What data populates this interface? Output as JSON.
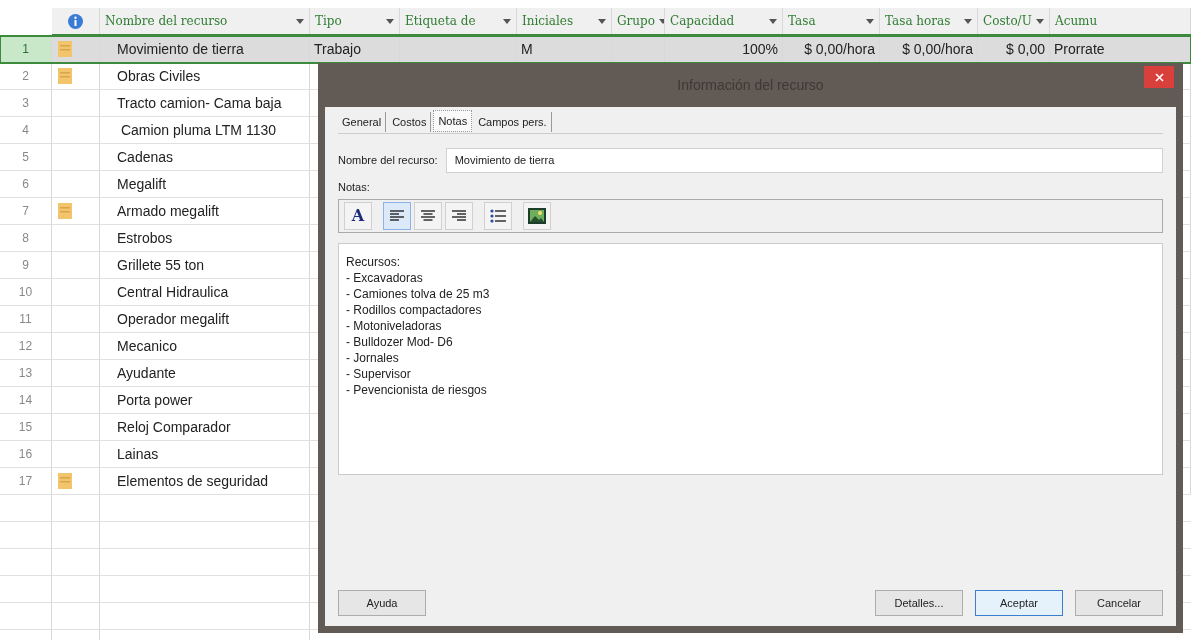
{
  "table": {
    "columns": [
      {
        "label": "Nombre del recurso",
        "kind": "text",
        "dropdown": true
      },
      {
        "label": "Tipo",
        "kind": "text",
        "dropdown": true
      },
      {
        "label": "Etiqueta de",
        "kind": "text",
        "dropdown": true
      },
      {
        "label": "Iniciales",
        "kind": "text",
        "dropdown": true
      },
      {
        "label": "Grupo",
        "kind": "text",
        "dropdown": true
      },
      {
        "label": "Capacidad",
        "kind": "number",
        "dropdown": true
      },
      {
        "label": "Tasa",
        "kind": "number",
        "dropdown": true
      },
      {
        "label": "Tasa horas",
        "kind": "number",
        "dropdown": true
      },
      {
        "label": "Costo/U",
        "kind": "number",
        "dropdown": true
      },
      {
        "label": "Acumu",
        "kind": "text",
        "dropdown": false
      }
    ],
    "rows": [
      {
        "number": "1",
        "notes": true,
        "selected": true,
        "cells": [
          "Movimiento de tierra",
          "Trabajo",
          null,
          "M",
          null,
          "100%",
          "$ 0,00/hora",
          "$ 0,00/hora",
          "$ 0,00",
          "Prorrate"
        ]
      },
      {
        "number": "2",
        "notes": true,
        "selected": false,
        "cells": [
          "Obras Civiles"
        ]
      },
      {
        "number": "3",
        "notes": false,
        "selected": false,
        "cells": [
          "Tracto camion- Cama baja"
        ]
      },
      {
        "number": "4",
        "notes": false,
        "selected": false,
        "cells": [
          " Camion pluma LTM 1130"
        ]
      },
      {
        "number": "5",
        "notes": false,
        "selected": false,
        "cells": [
          "Cadenas"
        ]
      },
      {
        "number": "6",
        "notes": false,
        "selected": false,
        "cells": [
          "Megalift"
        ]
      },
      {
        "number": "7",
        "notes": true,
        "selected": false,
        "cells": [
          "Armado megalift"
        ]
      },
      {
        "number": "8",
        "notes": false,
        "selected": false,
        "cells": [
          "Estrobos"
        ]
      },
      {
        "number": "9",
        "notes": false,
        "selected": false,
        "cells": [
          "Grillete 55 ton"
        ]
      },
      {
        "number": "10",
        "notes": false,
        "selected": false,
        "cells": [
          "Central Hidraulica"
        ]
      },
      {
        "number": "11",
        "notes": false,
        "selected": false,
        "cells": [
          "Operador megalift"
        ]
      },
      {
        "number": "12",
        "notes": false,
        "selected": false,
        "cells": [
          "Mecanico"
        ]
      },
      {
        "number": "13",
        "notes": false,
        "selected": false,
        "cells": [
          "Ayudante"
        ]
      },
      {
        "number": "14",
        "notes": false,
        "selected": false,
        "cells": [
          "Porta power"
        ]
      },
      {
        "number": "15",
        "notes": false,
        "selected": false,
        "cells": [
          "Reloj Comparador"
        ]
      },
      {
        "number": "16",
        "notes": false,
        "selected": false,
        "cells": [
          "Lainas"
        ]
      },
      {
        "number": "17",
        "notes": true,
        "selected": false,
        "cells": [
          "Elementos de seguridad"
        ]
      }
    ]
  },
  "dialog": {
    "title": "Información del recurso",
    "tabs": [
      {
        "label": "General",
        "selected": false
      },
      {
        "label": "Costos",
        "selected": false
      },
      {
        "label": "Notas",
        "selected": true
      },
      {
        "label": "Campos pers.",
        "selected": false
      }
    ],
    "name_label": "Nombre del recurso:",
    "name_value": "Movimiento de tierra",
    "notes_label": "Notas:",
    "toolbar": [
      {
        "kind": "font",
        "label": "A",
        "selected": false
      },
      {
        "kind": "align-left",
        "selected": true
      },
      {
        "kind": "align-center",
        "selected": false
      },
      {
        "kind": "align-right",
        "selected": false
      },
      {
        "kind": "bullets",
        "selected": false
      },
      {
        "kind": "image",
        "selected": false
      }
    ],
    "notes": [
      "Recursos:",
      "- Excavadoras",
      "- Camiones tolva de 25 m3",
      "- Rodillos compactadores",
      "- Motoniveladoras",
      "- Bulldozer Mod- D6",
      "- Jornales",
      "- Supervisor",
      "- Pevencionista de riesgos"
    ],
    "buttons": [
      {
        "label": "Ayuda",
        "default": false
      },
      {
        "label": "Detalles...",
        "default": false
      },
      {
        "label": "Aceptar",
        "default": true
      },
      {
        "label": "Cancelar",
        "default": false
      }
    ]
  }
}
